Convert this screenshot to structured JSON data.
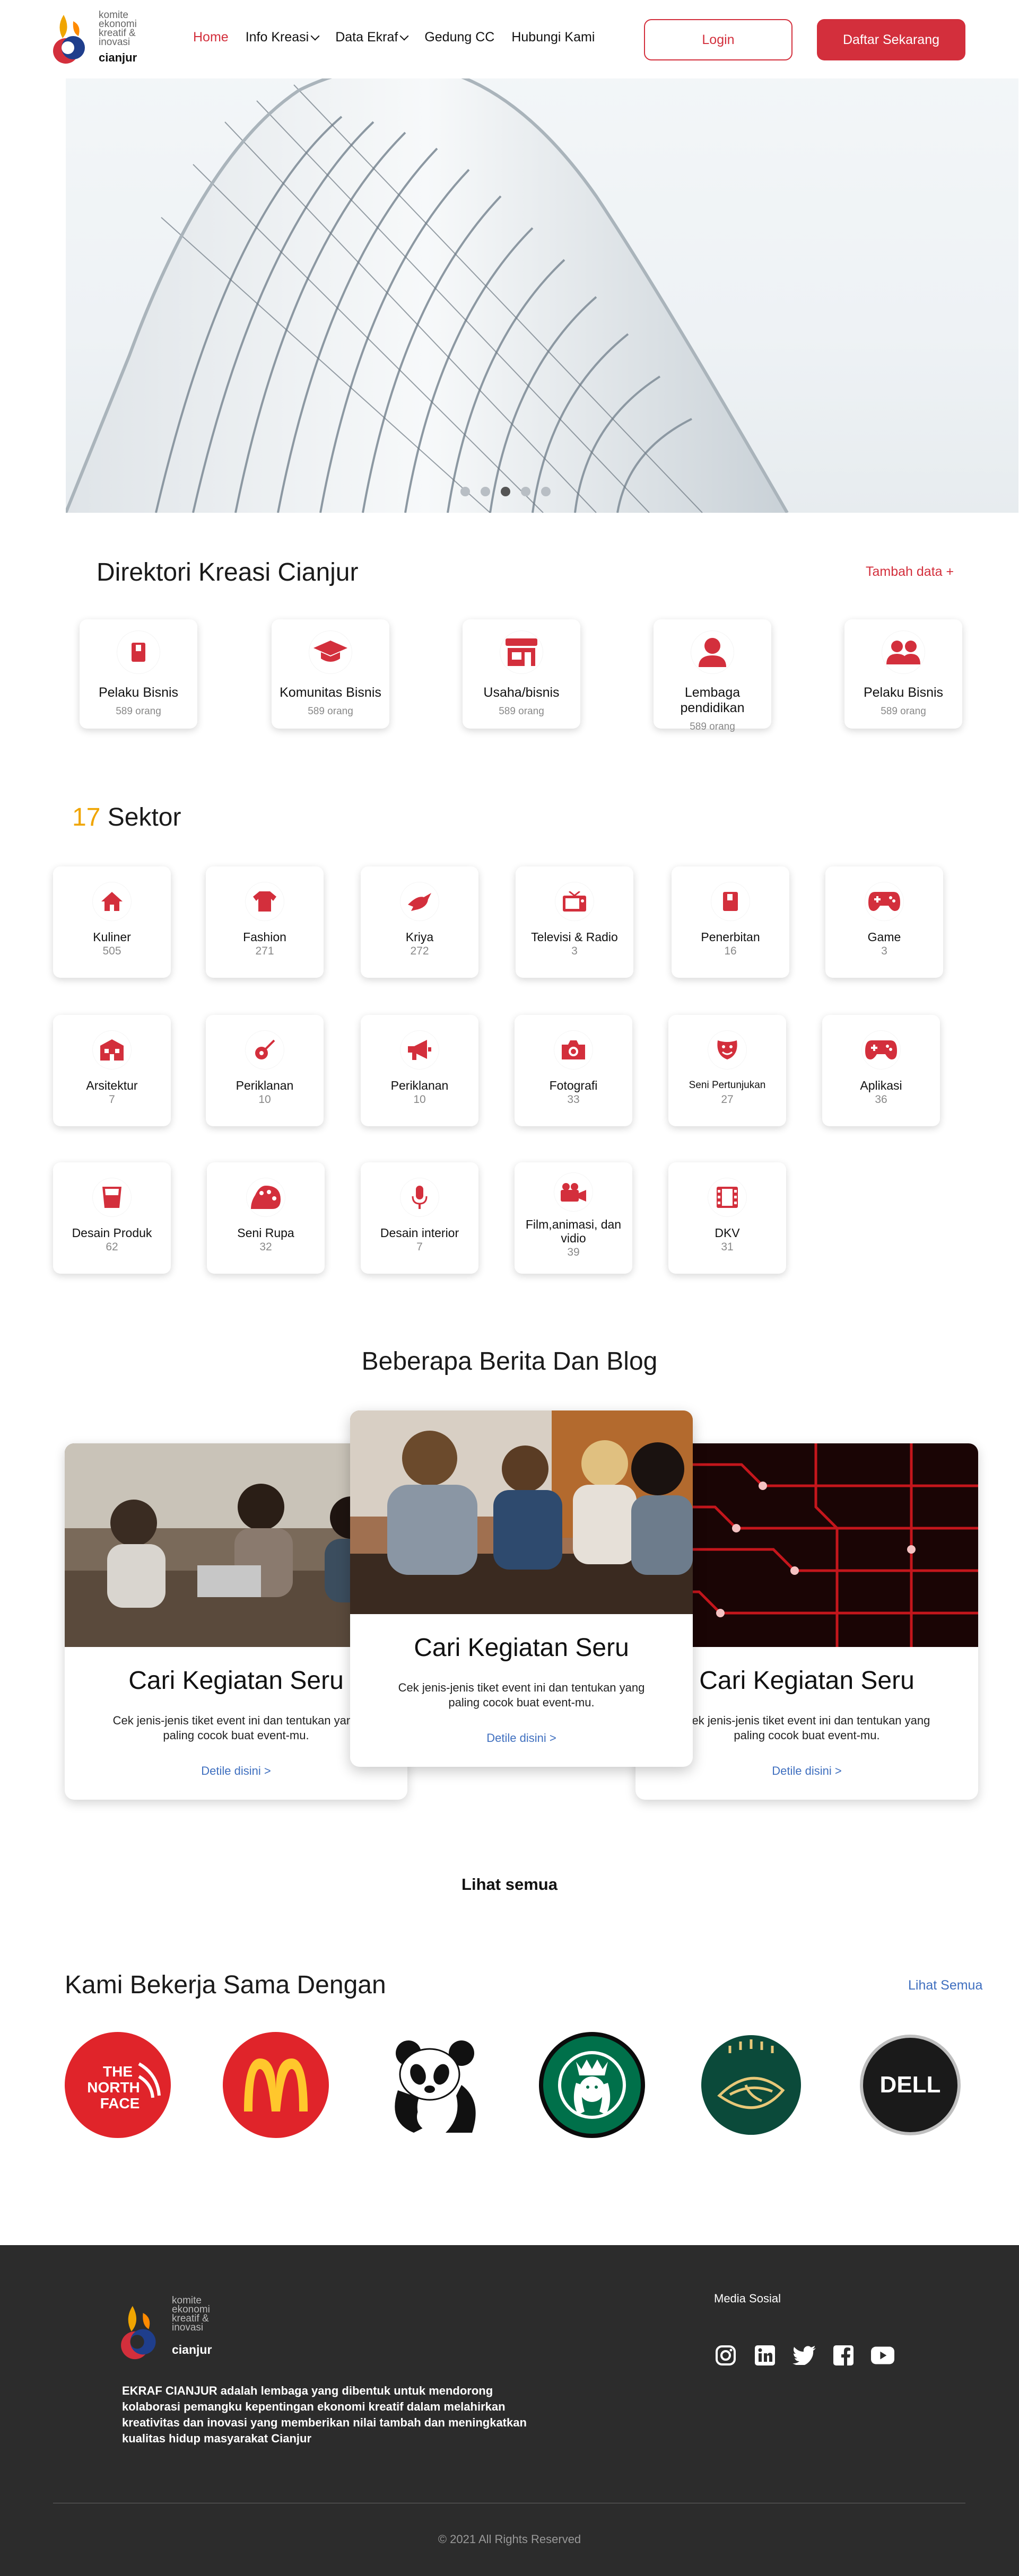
{
  "nav": {
    "logo_lines": [
      "komite",
      "ekonomi",
      "kreatif &",
      "inovasi"
    ],
    "logo_city": "cianjur",
    "menu": [
      {
        "label": "Home",
        "active": true,
        "dropdown": false
      },
      {
        "label": "Info Kreasi",
        "active": false,
        "dropdown": true
      },
      {
        "label": "Data Ekraf",
        "active": false,
        "dropdown": true
      },
      {
        "label": "Gedung CC",
        "active": false,
        "dropdown": false
      },
      {
        "label": "Hubungi Kami",
        "active": false,
        "dropdown": false
      }
    ],
    "login_label": "Login",
    "register_label": "Daftar Sekarang"
  },
  "hero": {
    "slides": 5,
    "active_slide": 3
  },
  "direktori": {
    "title": "Direktori Kreasi Cianjur",
    "add_label": "Tambah data +",
    "items": [
      {
        "label": "Pelaku Bisnis",
        "count": "589 orang",
        "icon": "book-icon"
      },
      {
        "label": "Komunitas Bisnis",
        "count": "589 orang",
        "icon": "graduation-cap-icon"
      },
      {
        "label": "Usaha/bisnis",
        "count": "589 orang",
        "icon": "store-icon"
      },
      {
        "label": "Lembaga pendidikan",
        "count": "589 orang",
        "icon": "person-icon"
      },
      {
        "label": "Pelaku Bisnis",
        "count": "589 orang",
        "icon": "people-icon"
      }
    ]
  },
  "sektor": {
    "count": "17",
    "title": "Sektor",
    "items": [
      {
        "label": "Kuliner",
        "count": "505",
        "icon": "home-icon"
      },
      {
        "label": "Fashion",
        "count": "271",
        "icon": "shirt-icon"
      },
      {
        "label": "Kriya",
        "count": "272",
        "icon": "dove-icon"
      },
      {
        "label": "Televisi & Radio",
        "count": "3",
        "icon": "tv-icon"
      },
      {
        "label": "Penerbitan",
        "count": "16",
        "icon": "book-icon"
      },
      {
        "label": "Game",
        "count": "3",
        "icon": "gamepad-icon"
      },
      {
        "label": "Arsitektur",
        "count": "7",
        "icon": "building-icon"
      },
      {
        "label": "Periklanan",
        "count": "10",
        "icon": "guitar-icon"
      },
      {
        "label": "Periklanan",
        "count": "10",
        "icon": "megaphone-icon"
      },
      {
        "label": "Fotografi",
        "count": "33",
        "icon": "camera-icon"
      },
      {
        "label": "Seni Pertunjukan",
        "count": "27",
        "icon": "theater-mask-icon"
      },
      {
        "label": "Aplikasi",
        "count": "36",
        "icon": "gamepad-icon"
      },
      {
        "label": "Desain Produk",
        "count": "62",
        "icon": "glass-icon"
      },
      {
        "label": "Seni Rupa",
        "count": "32",
        "icon": "palette-icon"
      },
      {
        "label": "Desain interior",
        "count": "7",
        "icon": "microphone-icon"
      },
      {
        "label": "Film,animasi, dan vidio",
        "count": "39",
        "icon": "video-camera-icon"
      },
      {
        "label": "DKV",
        "count": "31",
        "icon": "film-icon"
      }
    ]
  },
  "berita": {
    "title": "Beberapa Berita Dan Blog",
    "cards": [
      {
        "heading": "Cari Kegiatan Seru",
        "text": "Cek jenis-jenis tiket event ini dan tentukan yang paling cocok buat event-mu.",
        "more": "Detile disini >"
      },
      {
        "heading": "Cari Kegiatan Seru",
        "text": "Cek jenis-jenis tiket event ini dan tentukan yang paling cocok buat event-mu.",
        "more": "Detile disini >"
      },
      {
        "heading": "Cari Kegiatan Seru",
        "text": "Cek jenis-jenis tiket event ini dan tentukan yang paling cocok buat event-mu.",
        "more": "Detile disini >"
      }
    ],
    "see_all": "Lihat semua"
  },
  "partners": {
    "title": "Kami Bekerja Sama Dengan",
    "see_all": "Lihat Semua",
    "logo_texts": {
      "northface": [
        "THE",
        "NORTH",
        "FACE"
      ],
      "dell": "DELL"
    },
    "logos": [
      "the-north-face-logo",
      "mcdonalds-logo",
      "wwf-panda-logo",
      "starbucks-logo",
      "leaf-brand-logo",
      "dell-logo"
    ]
  },
  "footer": {
    "logo_lines": [
      "komite",
      "ekonomi",
      "kreatif &",
      "inovasi"
    ],
    "logo_city": "cianjur",
    "description": "EKRAF CIANJUR adalah lembaga yang dibentuk untuk mendorong kolaborasi pemangku kepentingan ekonomi kreatif dalam melahirkan kreativitas dan inovasi yang memberikan nilai tambah dan meningkatkan kualitas hidup masyarakat Cianjur",
    "social_title": "Media Sosial",
    "social": [
      "instagram-icon",
      "linkedin-icon",
      "twitter-icon",
      "facebook-icon",
      "youtube-icon"
    ],
    "copyright": "© 2021 All Rights Reserved"
  },
  "colors": {
    "primary": "#d32f3c",
    "accent": "#f0a500",
    "link": "#3f6fbf",
    "footer_bg": "#2c2c2c"
  }
}
